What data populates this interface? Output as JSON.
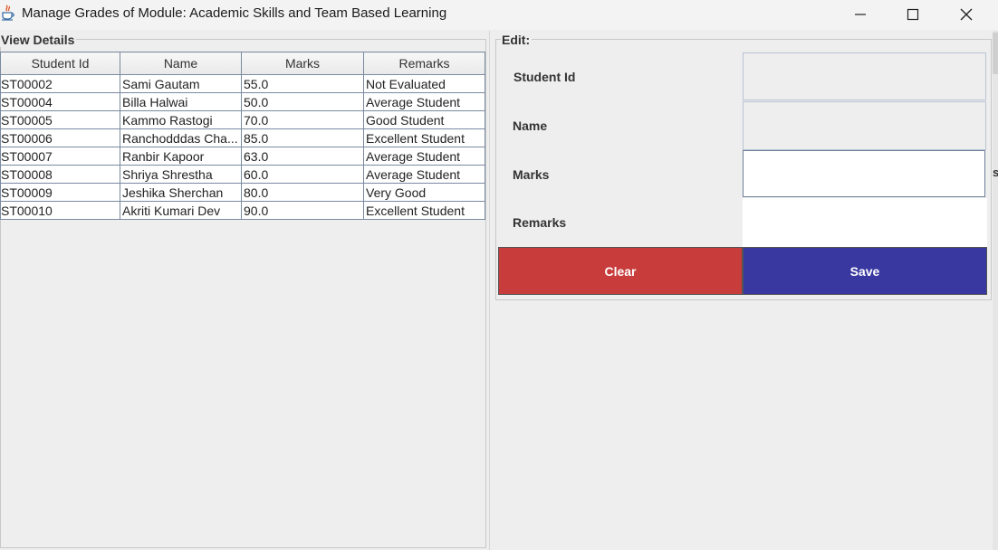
{
  "window": {
    "title": "Manage Grades of Module: Academic Skills and Team Based Learning"
  },
  "view_panel": {
    "legend": "View Details",
    "columns": [
      "Student Id",
      "Name",
      "Marks",
      "Remarks"
    ],
    "rows": [
      [
        "ST00002",
        "Sami Gautam",
        "55.0",
        "Not Evaluated"
      ],
      [
        "ST00004",
        "Billa Halwai",
        "50.0",
        "Average Student"
      ],
      [
        "ST00005",
        "Kammo Rastogi",
        "70.0",
        "Good Student"
      ],
      [
        "ST00006",
        "Ranchodddas Cha...",
        "85.0",
        "Excellent Student"
      ],
      [
        "ST00007",
        "Ranbir Kapoor",
        "63.0",
        "Average Student"
      ],
      [
        "ST00008",
        "Shriya Shrestha",
        "60.0",
        "Average Student"
      ],
      [
        "ST00009",
        "Jeshika Sherchan",
        "80.0",
        "Very Good"
      ],
      [
        "ST00010",
        "Akriti Kumari Dev",
        "90.0",
        "Excellent Student"
      ]
    ]
  },
  "edit_panel": {
    "legend": "Edit:",
    "student_id_label": "Student Id",
    "student_id_value": "",
    "name_label": "Name",
    "name_value": "",
    "marks_label": "Marks",
    "marks_value": "",
    "remarks_label": "Remarks",
    "remarks_value": "",
    "clear_label": "Clear",
    "save_label": "Save"
  },
  "edge_text": "s",
  "colors": {
    "clear_button": "#c83c3c",
    "save_button": "#3838a0",
    "background": "#eeeeee"
  },
  "icons": [
    "java-app-icon",
    "minimize-icon",
    "maximize-icon",
    "close-icon"
  ]
}
